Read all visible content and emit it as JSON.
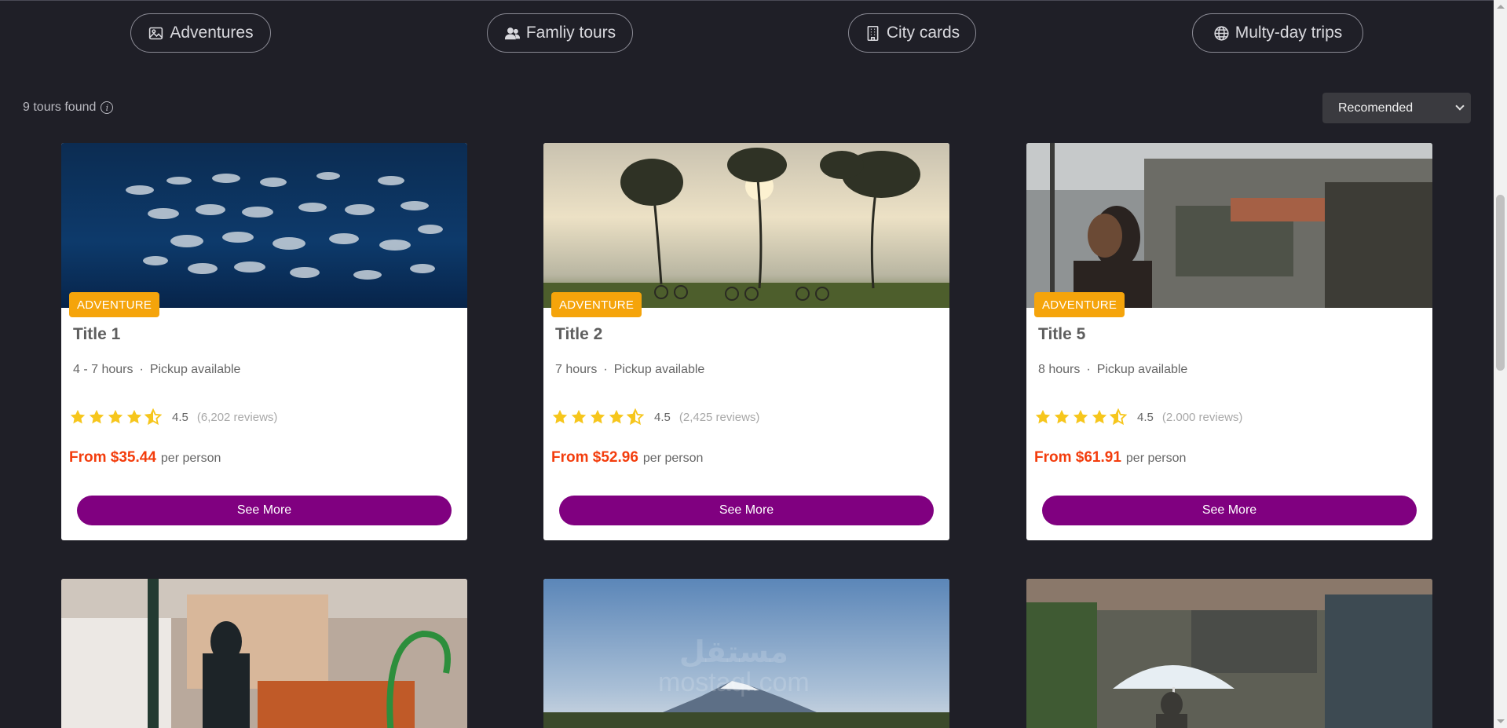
{
  "categories": [
    {
      "label": "Adventures",
      "icon": "image-icon"
    },
    {
      "label": "Famliy tours",
      "icon": "users-icon"
    },
    {
      "label": "City cards",
      "icon": "building-icon"
    },
    {
      "label": "Multy-day trips",
      "icon": "globe-icon"
    }
  ],
  "results": {
    "count_text": "9 tours found",
    "icon": "info-icon"
  },
  "sort": {
    "selected": "Recomended"
  },
  "cards": [
    {
      "badge": "ADVENTURE",
      "title": "Title 1",
      "duration": "4 - 7 hours",
      "pickup": "Pickup available",
      "score": "4.5",
      "reviews": "(6,202 reviews)",
      "price": "From $35.44",
      "per": "per person",
      "button": "See More",
      "rating": 4.5
    },
    {
      "badge": "ADVENTURE",
      "title": "Title 2",
      "duration": "7 hours",
      "pickup": "Pickup available",
      "score": "4.5",
      "reviews": "(2,425 reviews)",
      "price": "From $52.96",
      "per": "per person",
      "button": "See More",
      "rating": 4.5
    },
    {
      "badge": "ADVENTURE",
      "title": "Title 5",
      "duration": "8 hours",
      "pickup": "Pickup available",
      "score": "4.5",
      "reviews": "(2.000 reviews)",
      "price": "From $61.91",
      "per": "per person",
      "button": "See More",
      "rating": 4.5
    }
  ],
  "watermark": {
    "line1": "مستقل",
    "line2": "mostaql.com"
  },
  "colors": {
    "background": "#1f1f27",
    "badge": "#f5a40b",
    "price": "#f33d0d",
    "button": "#800080",
    "star": "#f6c61c"
  }
}
